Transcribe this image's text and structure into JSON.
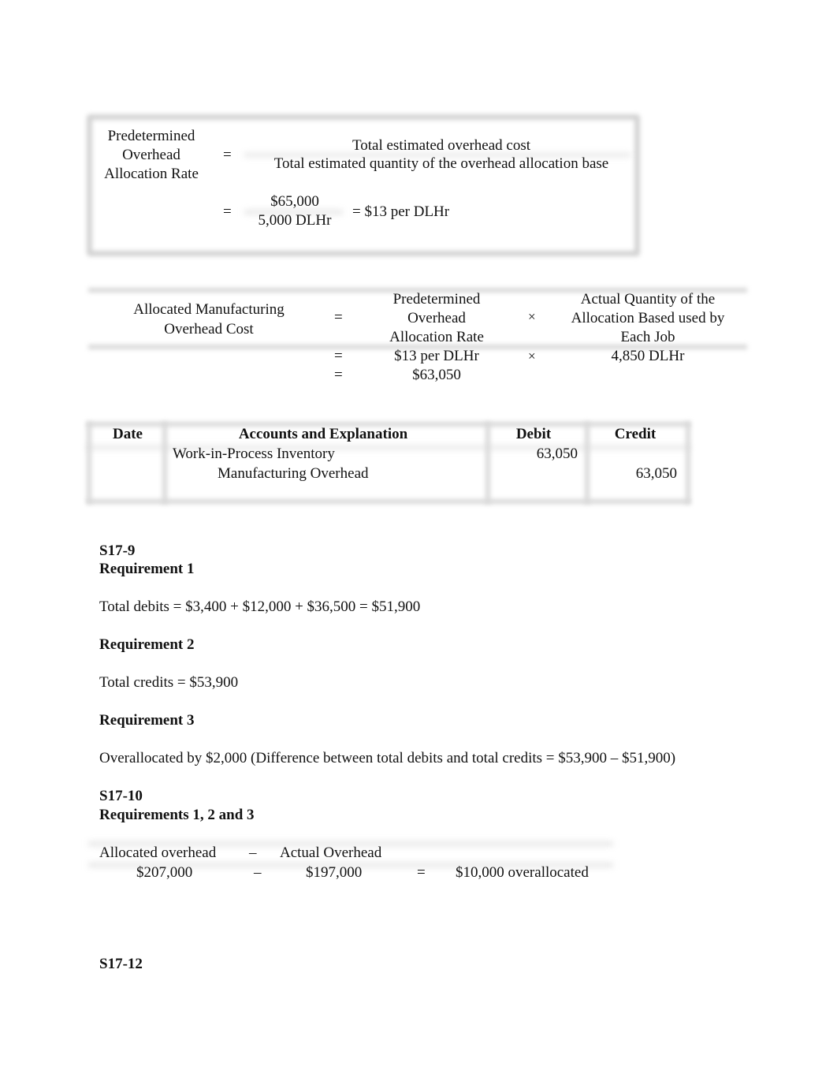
{
  "formula1": {
    "lhs": [
      "Predetermined",
      "Overhead",
      "Allocation Rate"
    ],
    "eq": "=",
    "numerator": "Total estimated overhead cost",
    "denominator": "Total estimated quantity of the overhead allocation base",
    "calc_eq": "=",
    "calc_numerator": "$65,000",
    "calc_denominator": "5,000 DLHr",
    "calc_result": "= $13 per DLHr"
  },
  "formula2": {
    "lhs": [
      "Allocated Manufacturing",
      "Overhead Cost"
    ],
    "eq": "=",
    "term1": [
      "Predetermined",
      "Overhead",
      "Allocation Rate"
    ],
    "times": "×",
    "term2": [
      "Actual Quantity of the",
      "Allocation Based used by",
      "Each Job"
    ],
    "row2_eq": "=",
    "row2_term1": "$13 per DLHr",
    "row2_times": "×",
    "row2_term2": "4,850 DLHr",
    "row3_eq": "=",
    "row3_result": "$63,050"
  },
  "journal": {
    "headers": [
      "Date",
      "Accounts and Explanation",
      "Debit",
      "Credit"
    ],
    "rows": [
      {
        "date": "",
        "account": "Work-in-Process Inventory",
        "debit": "63,050",
        "credit": ""
      },
      {
        "date": "",
        "account": "Manufacturing Overhead",
        "debit": "",
        "credit": "63,050"
      }
    ]
  },
  "s17_9": {
    "title": "S17-9",
    "req1_title": "Requirement 1",
    "req1_text": "Total debits = $3,400 + $12,000 + $36,500 = $51,900",
    "req2_title": "Requirement 2",
    "req2_text": "Total credits = $53,900",
    "req3_title": "Requirement 3",
    "req3_text": "Overallocated by $2,000 (Difference between total debits and total credits = $53,900 – $51,900)"
  },
  "s17_10": {
    "title": "S17-10",
    "req_title": "Requirements 1, 2 and 3",
    "h_allocated": "Allocated overhead",
    "h_minus": "–",
    "h_actual": "Actual Overhead",
    "v_allocated": "$207,000",
    "v_minus": "–",
    "v_actual": "$197,000",
    "v_eq": "=",
    "v_result": "$10,000 overallocated"
  },
  "s17_12": {
    "title": "S17-12"
  }
}
